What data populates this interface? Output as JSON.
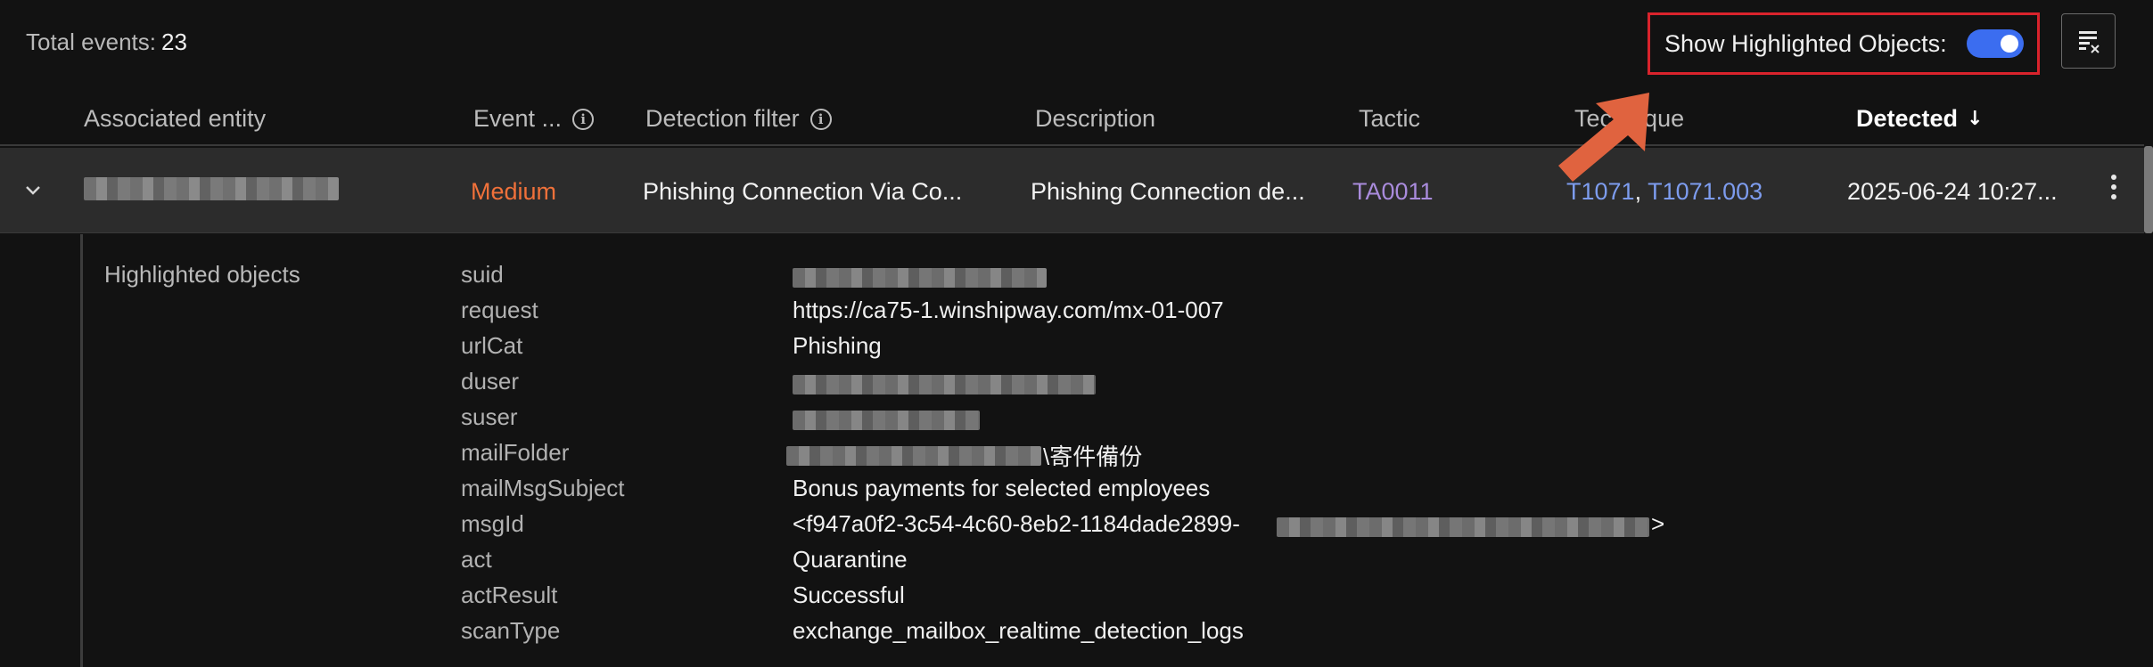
{
  "summary": {
    "label": "Total events:",
    "count": "23"
  },
  "toolbar": {
    "toggle_label": "Show Highlighted Objects:",
    "toggle_on": true
  },
  "columns": {
    "entity": "Associated entity",
    "event": "Event ...",
    "filter": "Detection filter",
    "description": "Description",
    "tactic": "Tactic",
    "technique": "Technique",
    "detected": "Detected"
  },
  "row": {
    "severity": "Medium",
    "filter": "Phishing Connection Via Co...",
    "description": "Phishing Connection de...",
    "tactic": "TA0011",
    "technique_1": "T1071",
    "separator": ",",
    "technique_2": "T1071.003",
    "detected": "2025-06-24 10:27..."
  },
  "details": {
    "title": "Highlighted objects",
    "items": [
      {
        "key": "suid",
        "value": ""
      },
      {
        "key": "request",
        "value": "https://ca75-1.winshipway.com/mx-01-007"
      },
      {
        "key": "urlCat",
        "value": "Phishing"
      },
      {
        "key": "duser",
        "value": ""
      },
      {
        "key": "suser",
        "value": ""
      },
      {
        "key": "mailFolder",
        "value": "\\寄件備份"
      },
      {
        "key": "mailMsgSubject",
        "value": "Bonus payments for selected employees"
      },
      {
        "key": "msgId",
        "value": "<f947a0f2-3c54-4c60-8eb2-1184dade2899-",
        "suffix": ">"
      },
      {
        "key": "act",
        "value": "Quarantine"
      },
      {
        "key": "actResult",
        "value": "Successful"
      },
      {
        "key": "scanType",
        "value": "exchange_mailbox_realtime_detection_logs"
      }
    ]
  },
  "colors": {
    "background": "#121212",
    "row_background": "#2c2c2c",
    "severity_medium": "#f0713a",
    "tactic_link": "#a98bdc",
    "technique_link": "#7d9cee",
    "toggle_on": "#3b6df0",
    "highlight_box": "#d9232c",
    "arrow": "#e0633f"
  }
}
